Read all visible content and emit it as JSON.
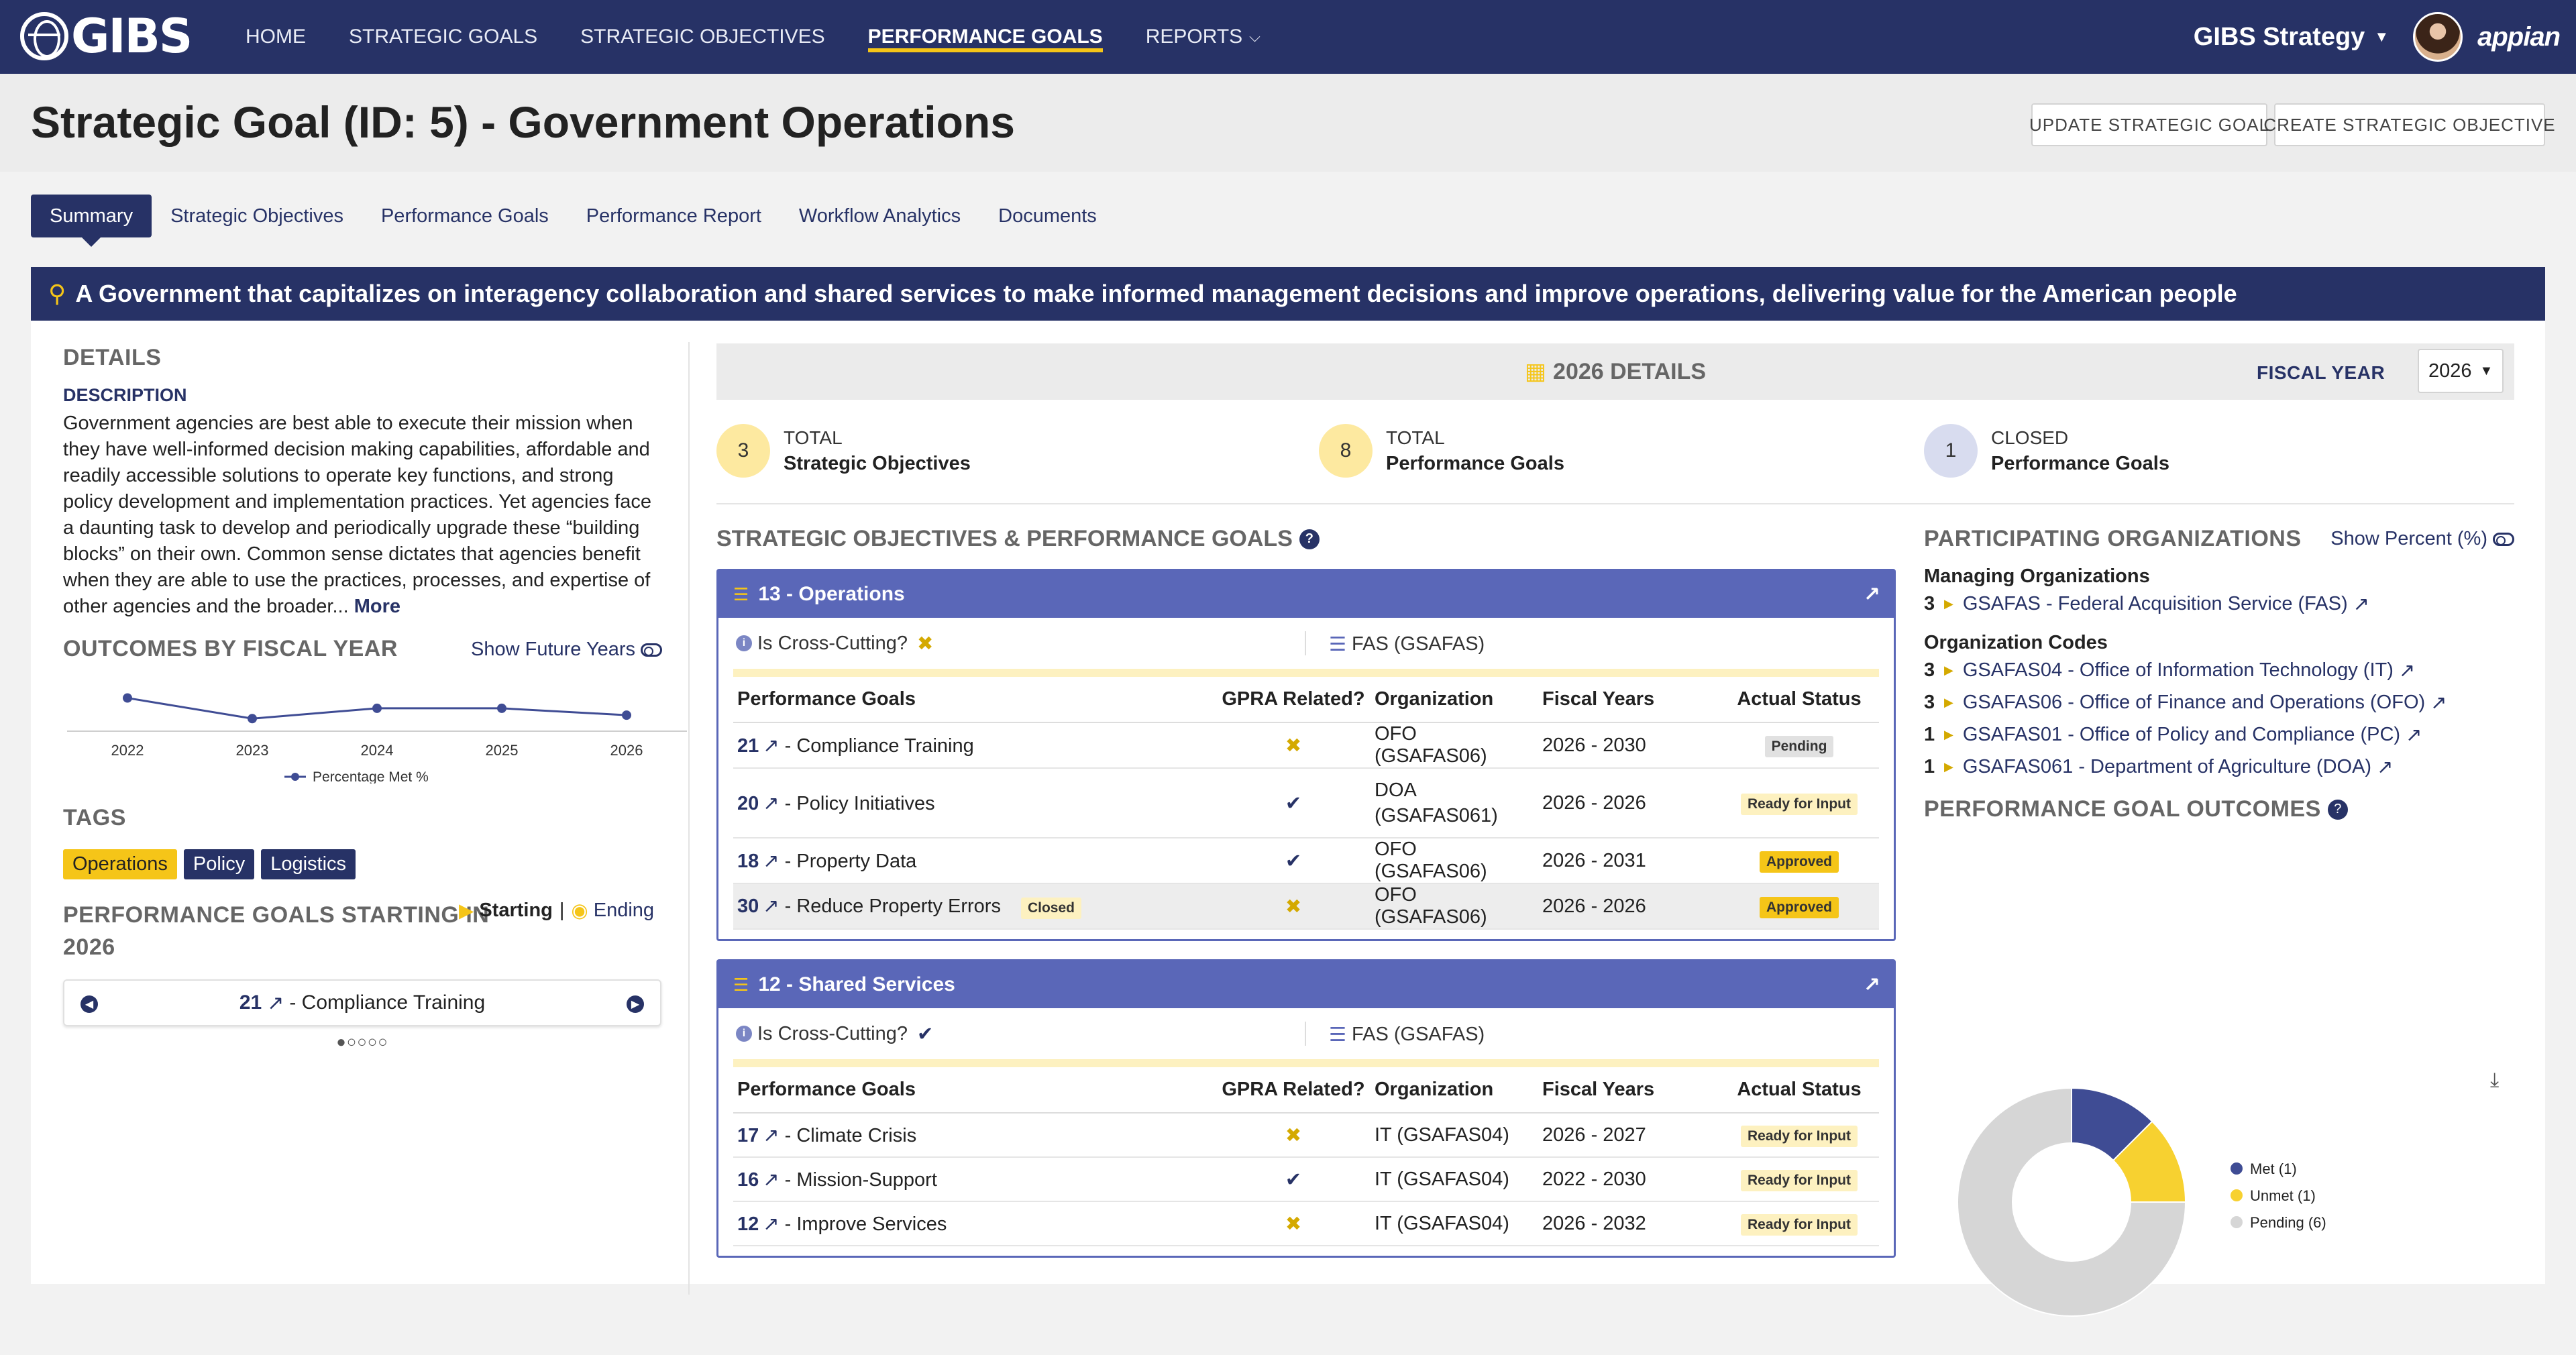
{
  "nav": {
    "logo": "GIBS",
    "links": [
      {
        "label": "HOME"
      },
      {
        "label": "STRATEGIC GOALS"
      },
      {
        "label": "STRATEGIC OBJECTIVES"
      },
      {
        "label": "PERFORMANCE GOALS"
      },
      {
        "label": "REPORTS"
      }
    ],
    "active_link": "PERFORMANCE GOALS",
    "app_title": "GIBS Strategy",
    "vendor": "appian"
  },
  "header": {
    "title": "Strategic Goal (ID: 5) - Government Operations",
    "update_button": "UPDATE STRATEGIC GOAL",
    "create_button": "CREATE STRATEGIC OBJECTIVE"
  },
  "tabs": [
    "Summary",
    "Strategic Objectives",
    "Performance Goals",
    "Performance Report",
    "Workflow Analytics",
    "Documents"
  ],
  "banner": "A Government that capitalizes on interagency collaboration and shared services to make informed management decisions and improve operations, delivering value for the American people",
  "details": {
    "title": "DETAILS",
    "description_label": "DESCRIPTION",
    "description": "Government agencies are best able to execute their mission when they have well-informed decision making capabilities, affordable and readily accessible solutions to operate key functions, and strong policy development and implementation practices. Yet agencies face a daunting task to develop and periodically upgrade these “building blocks” on their own. Common sense dictates that agencies benefit when they are able to use the practices, processes, and expertise of other agencies and the broader...",
    "more_link": "More"
  },
  "outcomes": {
    "title": "OUTCOMES BY FISCAL YEAR",
    "toggle_label": "Show Future Years",
    "legend": "Percentage Met %"
  },
  "chart_data": {
    "type": "line",
    "categories": [
      "2022",
      "2023",
      "2024",
      "2025",
      "2026"
    ],
    "series": [
      {
        "name": "Percentage Met %",
        "values": [
          60,
          30,
          45,
          45,
          35
        ]
      }
    ],
    "ylim": [
      0,
      100
    ],
    "grid": false,
    "legend": "bottom"
  },
  "tags": {
    "title": "TAGS",
    "items": [
      {
        "label": "Operations",
        "style": "yellow"
      },
      {
        "label": "Policy",
        "style": "navy"
      },
      {
        "label": "Logistics",
        "style": "navy"
      }
    ]
  },
  "starting": {
    "title": "PERFORMANCE GOALS STARTING IN 2026",
    "starting_label": "Starting",
    "separator": "|",
    "ending_label": "Ending",
    "item_id": "21",
    "item_name": "- Compliance Training",
    "pager": "●○○○○"
  },
  "fy_details": {
    "title": "2026 DETAILS",
    "fiscal_year_label": "FISCAL YEAR",
    "fiscal_year": "2026",
    "stats": [
      {
        "value": "3",
        "label1": "TOTAL",
        "label2": "Strategic Objectives",
        "color": "#fde9a0"
      },
      {
        "value": "8",
        "label1": "TOTAL",
        "label2": "Performance Goals",
        "color": "#fde9a0"
      },
      {
        "value": "1",
        "label1": "CLOSED",
        "label2": "Performance Goals",
        "color": "#d8dcef"
      }
    ]
  },
  "objectives": {
    "title": "STRATEGIC OBJECTIVES & PERFORMANCE GOALS",
    "columns": [
      "Performance Goals",
      "GPRA Related?",
      "Organization",
      "Fiscal Years",
      "Actual Status"
    ],
    "cross_cutting_label": "Is Cross-Cutting?",
    "items": [
      {
        "title": "13 - Operations",
        "cross_cutting": "✖",
        "org": "FAS (GSAFAS)",
        "rows": [
          {
            "id": "21",
            "name": "- Compliance Training",
            "gpra": "✖",
            "org": "OFO (GSAFAS06)",
            "years": "2026 - 2030",
            "status": "Pending",
            "status_style": "pending",
            "closed": ""
          },
          {
            "id": "20",
            "name": "- Policy Initiatives",
            "gpra": "✔",
            "org": "DOA (GSAFAS061)",
            "years": "2026 - 2026",
            "status": "Ready for Input",
            "status_style": "ready",
            "closed": ""
          },
          {
            "id": "18",
            "name": "- Property Data",
            "gpra": "✔",
            "org": "OFO (GSAFAS06)",
            "years": "2026 - 2031",
            "status": "Approved",
            "status_style": "approved",
            "closed": ""
          },
          {
            "id": "30",
            "name": "- Reduce Property Errors",
            "gpra": "✖",
            "org": "OFO (GSAFAS06)",
            "years": "2026 - 2026",
            "status": "Approved",
            "status_style": "approved",
            "closed": "Closed"
          }
        ]
      },
      {
        "title": "12 - Shared Services",
        "cross_cutting": "✔",
        "org": "FAS (GSAFAS)",
        "rows": [
          {
            "id": "17",
            "name": "- Climate Crisis",
            "gpra": "✖",
            "org": "IT (GSAFAS04)",
            "years": "2026 - 2027",
            "status": "Ready for Input",
            "status_style": "ready",
            "closed": ""
          },
          {
            "id": "16",
            "name": "- Mission-Support",
            "gpra": "✔",
            "org": "IT (GSAFAS04)",
            "years": "2022 - 2030",
            "status": "Ready for Input",
            "status_style": "ready",
            "closed": ""
          },
          {
            "id": "12",
            "name": "- Improve Services",
            "gpra": "✖",
            "org": "IT (GSAFAS04)",
            "years": "2026 - 2032",
            "status": "Ready for Input",
            "status_style": "ready",
            "closed": ""
          }
        ]
      }
    ]
  },
  "participating": {
    "title": "PARTICIPATING ORGANIZATIONS",
    "toggle_label": "Show Percent (%)",
    "managing_label": "Managing Organizations",
    "managing": [
      {
        "count": "3",
        "name": "GSAFAS - Federal Acquisition Service (FAS)"
      }
    ],
    "codes_label": "Organization Codes",
    "codes": [
      {
        "count": "3",
        "name": "GSAFAS04 - Office of Information Technology (IT)"
      },
      {
        "count": "3",
        "name": "GSAFAS06 - Office of Finance and Operations (OFO)"
      },
      {
        "count": "1",
        "name": "GSAFAS01 - Office of Policy and Compliance (PC)"
      },
      {
        "count": "1",
        "name": "GSAFAS061 - Department of Agriculture (DOA)"
      }
    ]
  },
  "pg_outcomes": {
    "title": "PERFORMANCE GOAL OUTCOMES",
    "pie": {
      "type": "pie",
      "categories": [
        "Met (1)",
        "Unmet (1)",
        "Pending (6)"
      ],
      "values": [
        1,
        1,
        6
      ],
      "colors": [
        "#3f4c94",
        "#f7d130",
        "#d6d6d6"
      ]
    }
  }
}
